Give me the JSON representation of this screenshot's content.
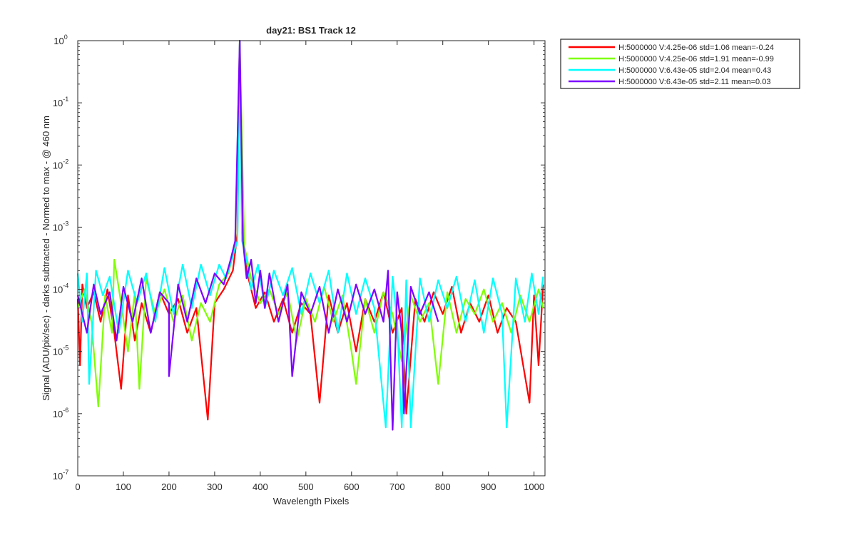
{
  "chart_data": {
    "type": "line",
    "title": "day21: BS1  Track 12",
    "xlabel": "Wavelength Pixels",
    "ylabel": "Signal (ADU/pix/sec) - darks subtracted - Normed to max - @ 460 nm",
    "xlim": [
      0,
      1024
    ],
    "ylim": [
      1e-07,
      1
    ],
    "yscale": "log",
    "xticks": [
      0,
      100,
      200,
      300,
      400,
      500,
      600,
      700,
      800,
      900,
      1000
    ],
    "xtick_labels": [
      "0",
      "100",
      "200",
      "300",
      "400",
      "500",
      "600",
      "700",
      "800",
      "900",
      "1000"
    ],
    "yticks": [
      {
        "value": 1,
        "base": "10",
        "exp": "0"
      },
      {
        "value": 0.1,
        "base": "10",
        "exp": "-1"
      },
      {
        "value": 0.01,
        "base": "10",
        "exp": "-2"
      },
      {
        "value": 0.001,
        "base": "10",
        "exp": "-3"
      },
      {
        "value": 0.0001,
        "base": "10",
        "exp": "-4"
      },
      {
        "value": 1e-05,
        "base": "10",
        "exp": "-5"
      },
      {
        "value": 1e-06,
        "base": "10",
        "exp": "-6"
      },
      {
        "value": 1e-07,
        "base": "10",
        "exp": "-7"
      }
    ],
    "legend_position": "outside-top-right",
    "peak": {
      "x": 355,
      "y": 1.0
    },
    "series": [
      {
        "name": "H:5000000 V:4.25e-06 std=1.06 mean=-0.24",
        "color": "#ff0000",
        "points": [
          [
            0,
            7e-05
          ],
          [
            5,
            6e-06
          ],
          [
            10,
            0.00012
          ],
          [
            20,
            5e-05
          ],
          [
            35,
            9e-05
          ],
          [
            50,
            3e-05
          ],
          [
            65,
            0.0001
          ],
          [
            80,
            2e-05
          ],
          [
            95,
            2.5e-06
          ],
          [
            110,
            8e-05
          ],
          [
            125,
            1.5e-05
          ],
          [
            140,
            6e-05
          ],
          [
            160,
            2e-05
          ],
          [
            180,
            9e-05
          ],
          [
            200,
            4e-05
          ],
          [
            220,
            7e-05
          ],
          [
            240,
            2e-05
          ],
          [
            260,
            5e-05
          ],
          [
            285,
            8e-07
          ],
          [
            300,
            6e-05
          ],
          [
            320,
            0.0001
          ],
          [
            340,
            0.0002
          ],
          [
            350,
            0.0008
          ],
          [
            355,
            1.0
          ],
          [
            360,
            0.0008
          ],
          [
            370,
            0.0002
          ],
          [
            390,
            5e-05
          ],
          [
            410,
            9e-05
          ],
          [
            430,
            3e-05
          ],
          [
            450,
            7e-05
          ],
          [
            470,
            2e-05
          ],
          [
            490,
            6e-05
          ],
          [
            510,
            4e-05
          ],
          [
            530,
            1.5e-06
          ],
          [
            550,
            8e-05
          ],
          [
            570,
            2e-05
          ],
          [
            590,
            6e-05
          ],
          [
            610,
            1e-05
          ],
          [
            630,
            7e-05
          ],
          [
            650,
            3e-05
          ],
          [
            670,
            9e-05
          ],
          [
            690,
            2e-05
          ],
          [
            710,
            5e-05
          ],
          [
            720,
            1e-06
          ],
          [
            740,
            7e-05
          ],
          [
            760,
            3e-05
          ],
          [
            780,
            9e-05
          ],
          [
            800,
            4e-05
          ],
          [
            820,
            0.00011
          ],
          [
            840,
            2e-05
          ],
          [
            860,
            6e-05
          ],
          [
            880,
            3e-05
          ],
          [
            900,
            8e-05
          ],
          [
            920,
            2e-05
          ],
          [
            940,
            5e-05
          ],
          [
            960,
            3e-05
          ],
          [
            990,
            1.5e-06
          ],
          [
            1000,
            8e-05
          ],
          [
            1010,
            6e-06
          ],
          [
            1020,
            0.00012
          ]
        ]
      },
      {
        "name": "H:5000000 V:4.25e-06 std=1.91 mean=-0.99",
        "color": "#7fff00",
        "points": [
          [
            0,
            5e-05
          ],
          [
            15,
            0.0001
          ],
          [
            30,
            3e-05
          ],
          [
            45,
            1.3e-06
          ],
          [
            60,
            8e-05
          ],
          [
            75,
            2e-05
          ],
          [
            80,
            0.0003
          ],
          [
            95,
            6e-05
          ],
          [
            110,
            1e-05
          ],
          [
            125,
            9e-05
          ],
          [
            135,
            2.5e-06
          ],
          [
            150,
            0.00015
          ],
          [
            170,
            4e-05
          ],
          [
            190,
            0.0001
          ],
          [
            210,
            3e-05
          ],
          [
            230,
            8e-05
          ],
          [
            250,
            1.5e-05
          ],
          [
            270,
            6e-05
          ],
          [
            290,
            3e-05
          ],
          [
            310,
            0.00012
          ],
          [
            330,
            0.00018
          ],
          [
            345,
            0.0005
          ],
          [
            355,
            1.0
          ],
          [
            365,
            0.0005
          ],
          [
            380,
            0.00015
          ],
          [
            400,
            6e-05
          ],
          [
            420,
            0.0001
          ],
          [
            440,
            4e-05
          ],
          [
            460,
            9e-05
          ],
          [
            480,
            1.5e-05
          ],
          [
            500,
            7e-05
          ],
          [
            520,
            3e-05
          ],
          [
            540,
            0.00011
          ],
          [
            560,
            3e-05
          ],
          [
            580,
            8e-05
          ],
          [
            600,
            1e-05
          ],
          [
            610,
            3e-06
          ],
          [
            630,
            7e-05
          ],
          [
            650,
            2e-05
          ],
          [
            670,
            9e-05
          ],
          [
            690,
            4e-05
          ],
          [
            710,
            7e-06
          ],
          [
            730,
            8e-05
          ],
          [
            750,
            3e-05
          ],
          [
            770,
            6e-05
          ],
          [
            790,
            3e-06
          ],
          [
            810,
            9e-05
          ],
          [
            830,
            2e-05
          ],
          [
            850,
            7e-05
          ],
          [
            870,
            4e-05
          ],
          [
            890,
            0.0001
          ],
          [
            910,
            3e-05
          ],
          [
            930,
            6e-05
          ],
          [
            950,
            2e-05
          ],
          [
            970,
            8e-05
          ],
          [
            990,
            3e-05
          ],
          [
            1010,
            0.0001
          ],
          [
            1020,
            5e-05
          ]
        ]
      },
      {
        "name": "H:5000000 V:6.43e-05 std=2.04 mean=0.43",
        "color": "#00ffff",
        "points": [
          [
            0,
            0.00018
          ],
          [
            10,
            3e-05
          ],
          [
            20,
            0.00018
          ],
          [
            25,
            3e-06
          ],
          [
            40,
            0.0002
          ],
          [
            55,
            8e-05
          ],
          [
            70,
            0.00016
          ],
          [
            90,
            2e-05
          ],
          [
            110,
            0.0002
          ],
          [
            130,
            6e-05
          ],
          [
            150,
            0.00018
          ],
          [
            170,
            3e-05
          ],
          [
            190,
            0.00022
          ],
          [
            210,
            4e-05
          ],
          [
            230,
            0.00025
          ],
          [
            250,
            5e-05
          ],
          [
            270,
            0.00025
          ],
          [
            290,
            8e-05
          ],
          [
            310,
            0.00025
          ],
          [
            325,
            0.00015
          ],
          [
            340,
            0.00035
          ],
          [
            350,
            0.0006
          ],
          [
            355,
            1.0
          ],
          [
            360,
            0.0006
          ],
          [
            370,
            0.0003
          ],
          [
            380,
            0.0001
          ],
          [
            395,
            0.00025
          ],
          [
            410,
            5e-05
          ],
          [
            430,
            0.0002
          ],
          [
            450,
            8e-05
          ],
          [
            470,
            0.00022
          ],
          [
            490,
            4e-05
          ],
          [
            510,
            0.00018
          ],
          [
            530,
            6e-05
          ],
          [
            550,
            0.0002
          ],
          [
            570,
            2e-05
          ],
          [
            590,
            0.00018
          ],
          [
            610,
            4e-05
          ],
          [
            630,
            0.00015
          ],
          [
            650,
            5e-05
          ],
          [
            675,
            6e-07
          ],
          [
            690,
            0.00016
          ],
          [
            700,
            3e-05
          ],
          [
            710,
            6e-07
          ],
          [
            720,
            0.00014
          ],
          [
            730,
            6e-07
          ],
          [
            750,
            0.00015
          ],
          [
            770,
            3e-05
          ],
          [
            790,
            0.00014
          ],
          [
            810,
            5e-05
          ],
          [
            830,
            0.00016
          ],
          [
            850,
            3e-05
          ],
          [
            870,
            0.00014
          ],
          [
            890,
            2e-05
          ],
          [
            910,
            0.00015
          ],
          [
            930,
            4e-05
          ],
          [
            940,
            6e-07
          ],
          [
            960,
            0.00015
          ],
          [
            980,
            3e-05
          ],
          [
            995,
            0.00018
          ],
          [
            1010,
            4e-05
          ],
          [
            1020,
            0.00016
          ]
        ]
      },
      {
        "name": "H:5000000 V:6.43e-05 std=2.11 mean=0.03",
        "color": "#7f00ff",
        "points": [
          [
            0,
            8e-05
          ],
          [
            20,
            2e-05
          ],
          [
            35,
            0.00012
          ],
          [
            50,
            4e-05
          ],
          [
            70,
            9e-05
          ],
          [
            85,
            1.5e-05
          ],
          [
            100,
            0.00011
          ],
          [
            120,
            3e-05
          ],
          [
            140,
            0.00015
          ],
          [
            160,
            2e-05
          ],
          [
            180,
            9e-05
          ],
          [
            200,
            6e-05
          ],
          [
            200,
            4e-06
          ],
          [
            220,
            0.00012
          ],
          [
            240,
            3e-05
          ],
          [
            260,
            0.00015
          ],
          [
            280,
            6e-05
          ],
          [
            300,
            0.00018
          ],
          [
            320,
            0.00012
          ],
          [
            335,
            0.0003
          ],
          [
            345,
            0.0006
          ],
          [
            355,
            1.0
          ],
          [
            362,
            0.0006
          ],
          [
            370,
            0.00015
          ],
          [
            380,
            0.0003
          ],
          [
            390,
            6e-05
          ],
          [
            400,
            0.0002
          ],
          [
            410,
            5e-05
          ],
          [
            420,
            0.00018
          ],
          [
            440,
            3e-05
          ],
          [
            460,
            0.00012
          ],
          [
            470,
            4e-06
          ],
          [
            490,
            9e-05
          ],
          [
            510,
            4e-05
          ],
          [
            530,
            0.00011
          ],
          [
            550,
            2e-05
          ],
          [
            570,
            0.0001
          ],
          [
            590,
            3e-05
          ],
          [
            610,
            0.00012
          ],
          [
            630,
            4e-05
          ],
          [
            650,
            0.0001
          ],
          [
            670,
            3e-05
          ],
          [
            680,
            0.0002
          ],
          [
            690,
            5.5e-07
          ],
          [
            700,
            9e-05
          ],
          [
            710,
            2e-05
          ],
          [
            715,
            1e-06
          ],
          [
            730,
            0.00011
          ],
          [
            750,
            4e-05
          ],
          [
            770,
            9e-05
          ],
          [
            790,
            3e-05
          ]
        ]
      }
    ]
  }
}
